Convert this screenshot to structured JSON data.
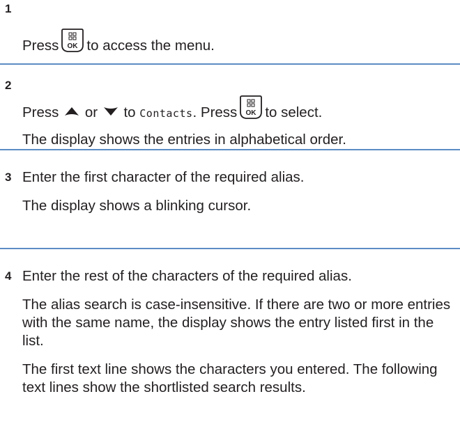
{
  "steps": [
    {
      "number": "1",
      "parts": [
        "Press",
        "to access the menu."
      ]
    },
    {
      "number": "2",
      "line1": {
        "press": "Press",
        "or": "or",
        "to": "to",
        "menu_item": "Contacts",
        "press2": ". Press",
        "to_select": "to select."
      },
      "result": "The display shows the entries in alphabetical order."
    },
    {
      "number": "3",
      "instruction": "Enter the first character of the required alias.",
      "result": "The display shows a blinking cursor."
    },
    {
      "number": "4",
      "instruction": "Enter the rest of the characters of the required alias.",
      "result1": "The alias search is case-insensitive. If there are two or more entries with the same name, the display shows the entry listed first in the list.",
      "result2": "The first text line shows the characters you entered. The following text lines show the shortlisted search results."
    }
  ],
  "icons": {
    "menu_ok_key": "menu-ok-key-icon",
    "up_arrow": "up-arrow-icon",
    "down_arrow": "down-arrow-icon"
  },
  "key_label": "OK",
  "colors": {
    "divider": "#5b8bc4",
    "text": "#231f20"
  }
}
